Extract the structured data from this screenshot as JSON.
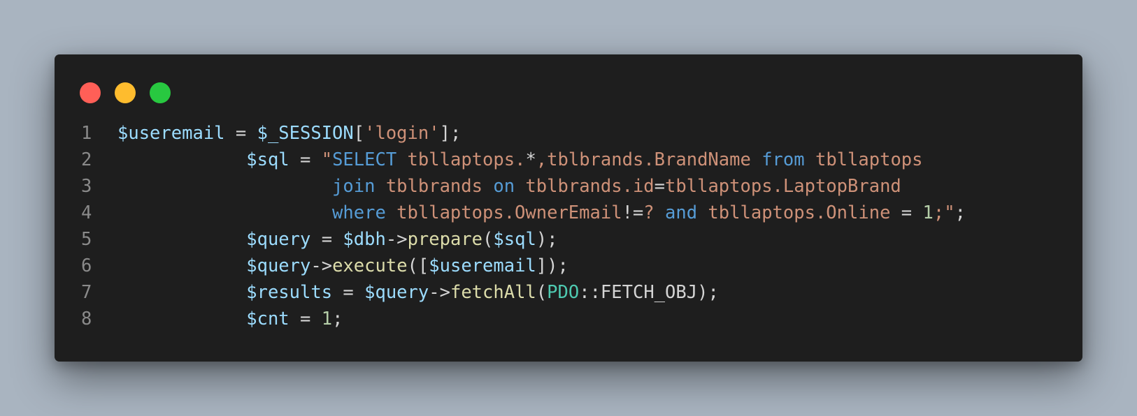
{
  "window_controls": {
    "close_color": "#ff5f57",
    "minimize_color": "#febc2e",
    "maximize_color": "#28c840"
  },
  "colors": {
    "background": "#a9b4c0",
    "editor_bg": "#1e1e1e",
    "variable": "#9cdcfe",
    "string": "#ce9178",
    "keyword": "#569cd6",
    "function": "#dcdcaa",
    "number": "#b5cea8",
    "class": "#4ec9b0",
    "default": "#d4d4d4",
    "line_number": "#8a8a8a"
  },
  "lines": [
    {
      "number": "1",
      "tokens": [
        {
          "text": "$useremail",
          "type": "variable"
        },
        {
          "text": " = ",
          "type": "default"
        },
        {
          "text": "$_SESSION",
          "type": "variable"
        },
        {
          "text": "[",
          "type": "default"
        },
        {
          "text": "'login'",
          "type": "string"
        },
        {
          "text": "];",
          "type": "default"
        }
      ]
    },
    {
      "number": "2",
      "tokens": [
        {
          "text": "            ",
          "type": "default"
        },
        {
          "text": "$sql",
          "type": "variable"
        },
        {
          "text": " = ",
          "type": "default"
        },
        {
          "text": "\"",
          "type": "string"
        },
        {
          "text": "SELECT",
          "type": "keyword"
        },
        {
          "text": " tbllaptops.",
          "type": "string"
        },
        {
          "text": "*",
          "type": "default"
        },
        {
          "text": ",tblbrands.BrandName ",
          "type": "string"
        },
        {
          "text": "from",
          "type": "keyword"
        },
        {
          "text": " tbllaptops",
          "type": "string"
        }
      ]
    },
    {
      "number": "3",
      "tokens": [
        {
          "text": "                    ",
          "type": "default"
        },
        {
          "text": "join",
          "type": "keyword"
        },
        {
          "text": " tblbrands ",
          "type": "string"
        },
        {
          "text": "on",
          "type": "keyword"
        },
        {
          "text": " tblbrands.id",
          "type": "string"
        },
        {
          "text": "=",
          "type": "default"
        },
        {
          "text": "tbllaptops.LaptopBrand",
          "type": "string"
        }
      ]
    },
    {
      "number": "4",
      "tokens": [
        {
          "text": "                    ",
          "type": "default"
        },
        {
          "text": "where",
          "type": "keyword"
        },
        {
          "text": " tbllaptops.OwnerEmail",
          "type": "string"
        },
        {
          "text": "!=",
          "type": "default"
        },
        {
          "text": "? ",
          "type": "string"
        },
        {
          "text": "and",
          "type": "keyword"
        },
        {
          "text": " tbllaptops.Online ",
          "type": "string"
        },
        {
          "text": "=",
          "type": "default"
        },
        {
          "text": " ",
          "type": "string"
        },
        {
          "text": "1",
          "type": "number"
        },
        {
          "text": ";\"",
          "type": "string"
        },
        {
          "text": ";",
          "type": "default"
        }
      ]
    },
    {
      "number": "5",
      "tokens": [
        {
          "text": "            ",
          "type": "default"
        },
        {
          "text": "$query",
          "type": "variable"
        },
        {
          "text": " = ",
          "type": "default"
        },
        {
          "text": "$dbh",
          "type": "variable"
        },
        {
          "text": "->",
          "type": "default"
        },
        {
          "text": "prepare",
          "type": "function"
        },
        {
          "text": "(",
          "type": "default"
        },
        {
          "text": "$sql",
          "type": "variable"
        },
        {
          "text": ");",
          "type": "default"
        }
      ]
    },
    {
      "number": "6",
      "tokens": [
        {
          "text": "            ",
          "type": "default"
        },
        {
          "text": "$query",
          "type": "variable"
        },
        {
          "text": "->",
          "type": "default"
        },
        {
          "text": "execute",
          "type": "function"
        },
        {
          "text": "([",
          "type": "default"
        },
        {
          "text": "$useremail",
          "type": "variable"
        },
        {
          "text": "]);",
          "type": "default"
        }
      ]
    },
    {
      "number": "7",
      "tokens": [
        {
          "text": "            ",
          "type": "default"
        },
        {
          "text": "$results",
          "type": "variable"
        },
        {
          "text": " = ",
          "type": "default"
        },
        {
          "text": "$query",
          "type": "variable"
        },
        {
          "text": "->",
          "type": "default"
        },
        {
          "text": "fetchAll",
          "type": "function"
        },
        {
          "text": "(",
          "type": "default"
        },
        {
          "text": "PDO",
          "type": "class"
        },
        {
          "text": "::FETCH_OBJ);",
          "type": "default"
        }
      ]
    },
    {
      "number": "8",
      "tokens": [
        {
          "text": "            ",
          "type": "default"
        },
        {
          "text": "$cnt",
          "type": "variable"
        },
        {
          "text": " = ",
          "type": "default"
        },
        {
          "text": "1",
          "type": "number"
        },
        {
          "text": ";",
          "type": "default"
        }
      ]
    }
  ]
}
